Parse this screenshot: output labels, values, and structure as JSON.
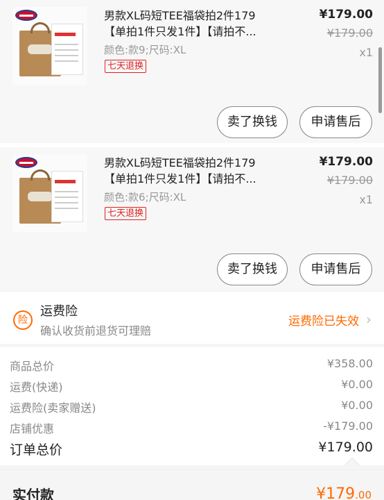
{
  "items": [
    {
      "title_line1": "男款XL码短TEE福袋拍2件179",
      "title_line2": "【单拍1件只发1件】【请拍不...",
      "spec": "颜色:款9;尺码:XL",
      "badge": "七天退换",
      "price": "¥179.00",
      "original_price": "¥179.00",
      "quantity": "x1",
      "btn_sell": "卖了换钱",
      "btn_after_sale": "申请售后",
      "thumb_card_text": "店铺标识"
    },
    {
      "title_line1": "男款XL码短TEE福袋拍2件179",
      "title_line2": "【单拍1件只发1件】【请拍不...",
      "spec": "颜色:款6;尺码:XL",
      "badge": "七天退换",
      "price": "¥179.00",
      "original_price": "¥179.00",
      "quantity": "x1",
      "btn_sell": "卖了换钱",
      "btn_after_sale": "申请售后",
      "thumb_card_text": "店铺标识"
    }
  ],
  "insurance": {
    "icon_glyph": "险",
    "title": "运费险",
    "subtitle": "确认收货前退货可理赔",
    "status": "运费险已失效",
    "status_color": "#ff6a00"
  },
  "summary": {
    "rows": [
      {
        "label": "商品总价",
        "value": "¥358.00"
      },
      {
        "label": "运费(快递)",
        "value": "¥0.00"
      },
      {
        "label": "运费险(卖家赠送)",
        "value": "¥0.00"
      },
      {
        "label": "店铺优惠",
        "value": "-¥179.00"
      }
    ],
    "total_label": "订单总价",
    "total_value": "¥179.00"
  },
  "paid": {
    "label": "实付款",
    "value_main": "¥179",
    "value_decimal": ".00",
    "color": "#ff6a00"
  },
  "icons": {
    "chevron": "chevron-right-icon",
    "insurance": "insurance-icon"
  }
}
